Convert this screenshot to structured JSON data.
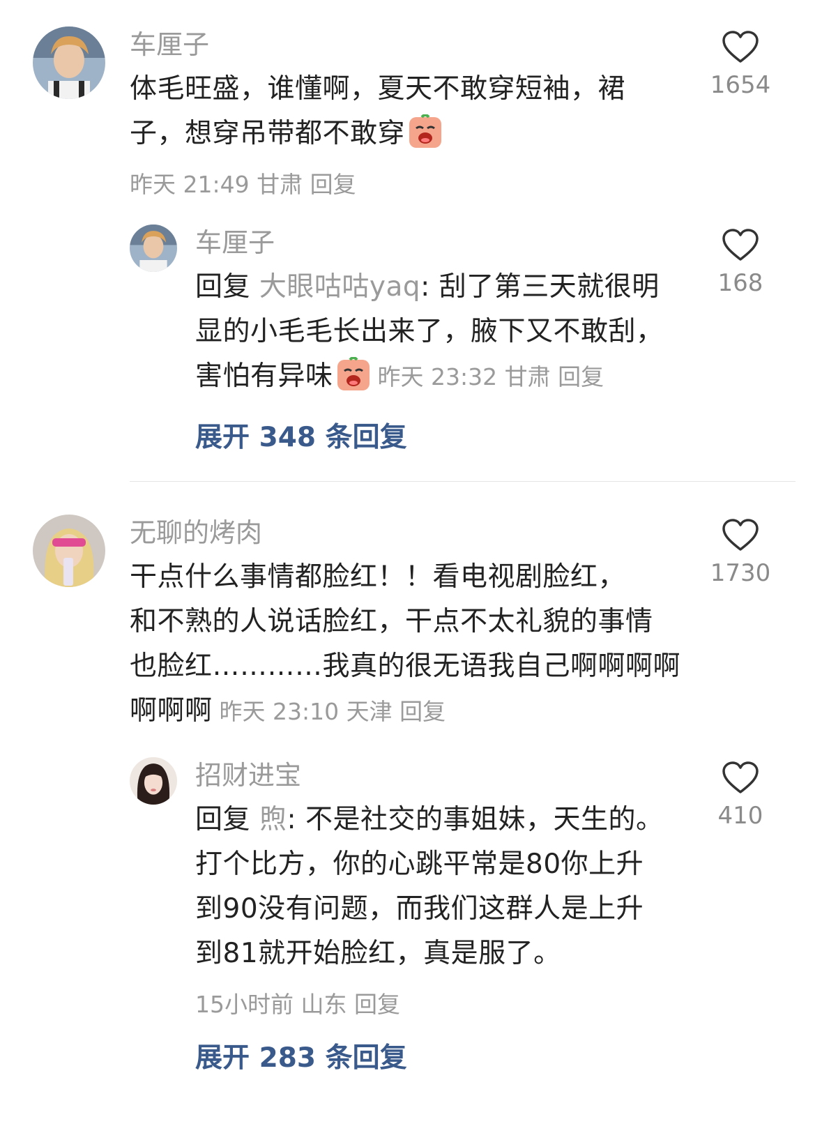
{
  "comments": [
    {
      "author": "车厘子",
      "text_line1": "体毛旺盛，谁懂啊，夏天不敢穿短袖，裙",
      "text_line2": "子，想穿吊带都不敢穿",
      "meta": "昨天 21:49 甘肃 回复",
      "likes": "1654",
      "reply": {
        "author": "车厘子",
        "prefix": "回复",
        "reply_to": "大眼咕咕yaq",
        "text_line1": ": 刮了第三天就很明",
        "text_line2": "显的小毛毛长出来了，腋下又不敢刮，",
        "text_line3": "害怕有异味",
        "meta": "昨天 23:32 甘肃 回复",
        "likes": "168"
      },
      "expand": "展开 348 条回复"
    },
    {
      "author": "无聊的烤肉",
      "text_line1": "干点什么事情都脸红！！看电视剧脸红，",
      "text_line2": "和不熟的人说话脸红，干点不太礼貌的事情",
      "text_line3": "也脸红…………我真的很无语我自己啊啊啊啊",
      "text_line4": "啊啊啊",
      "meta": "昨天 23:10 天津 回复",
      "likes": "1730",
      "reply": {
        "author": "招财进宝",
        "prefix": "回复",
        "reply_to": "煦",
        "text_line1": ": 不是社交的事姐妹，天生的。",
        "text_line2": "打个比方，你的心跳平常是80你上升",
        "text_line3": "到90没有问题，而我们这群人是上升",
        "text_line4": "到81就开始脸红，真是服了。",
        "meta": "15小时前 山东 回复",
        "likes": "410"
      },
      "expand": "展开 283 条回复"
    }
  ],
  "colors": {
    "link": "#3a5a8c",
    "muted": "#9a9a9a",
    "text": "#222222"
  },
  "icons": [
    "heart-icon",
    "crying-emoji-icon"
  ]
}
